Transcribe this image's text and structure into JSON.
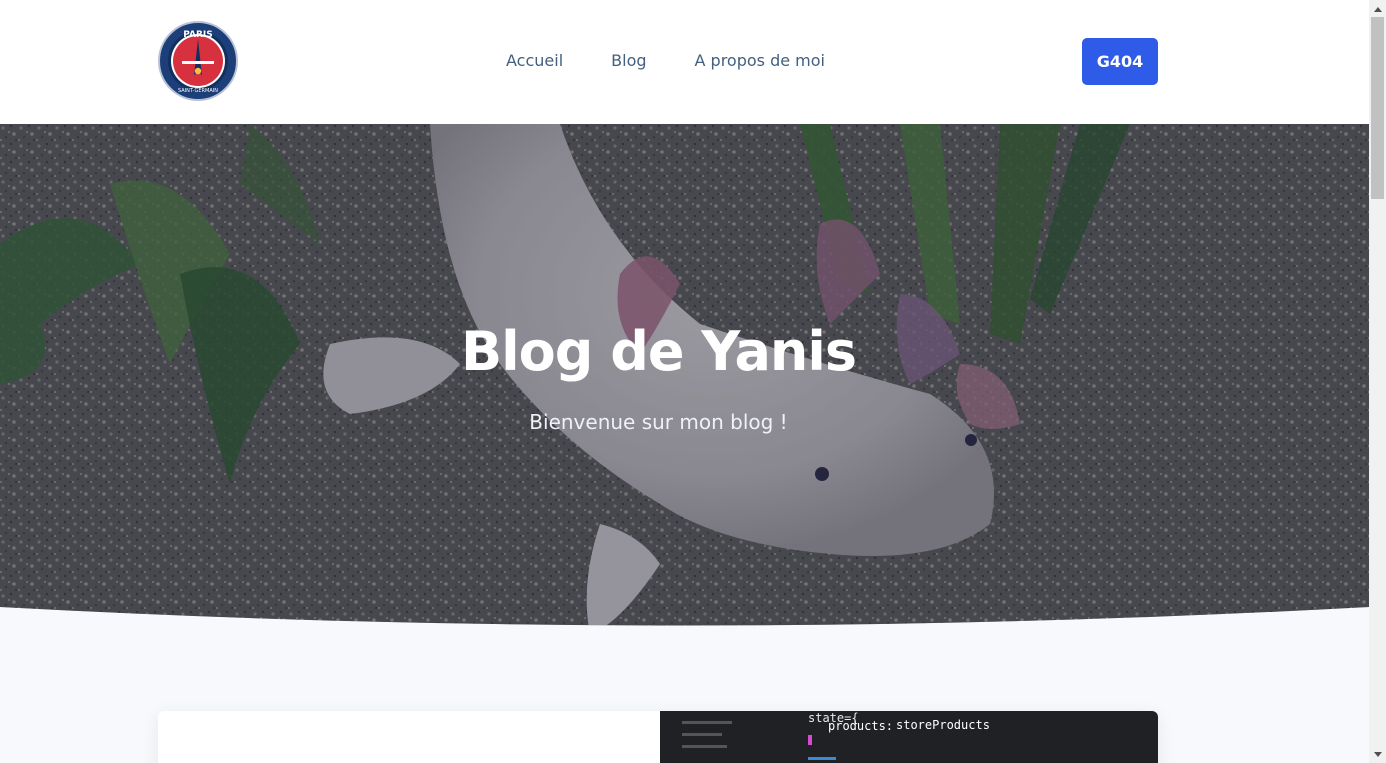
{
  "header": {
    "logo_alt": "Paris Saint-Germain",
    "nav": [
      {
        "label": "Accueil"
      },
      {
        "label": "Blog"
      },
      {
        "label": "A propos de moi"
      }
    ],
    "cta_label": "G404"
  },
  "hero": {
    "title": "Blog de Yanis",
    "subtitle": "Bienvenue sur mon blog !"
  },
  "article_preview": {
    "code_line_1": "state={",
    "code_line_2_key": "products:",
    "code_line_2_value": " storeProducts"
  },
  "colors": {
    "cta_bg": "#2f5be9",
    "nav_text": "#44607e",
    "page_bg": "#f7f9fc"
  },
  "logo": {
    "text_top": "PARIS",
    "text_bottom": "SAINT-GERMAIN"
  }
}
